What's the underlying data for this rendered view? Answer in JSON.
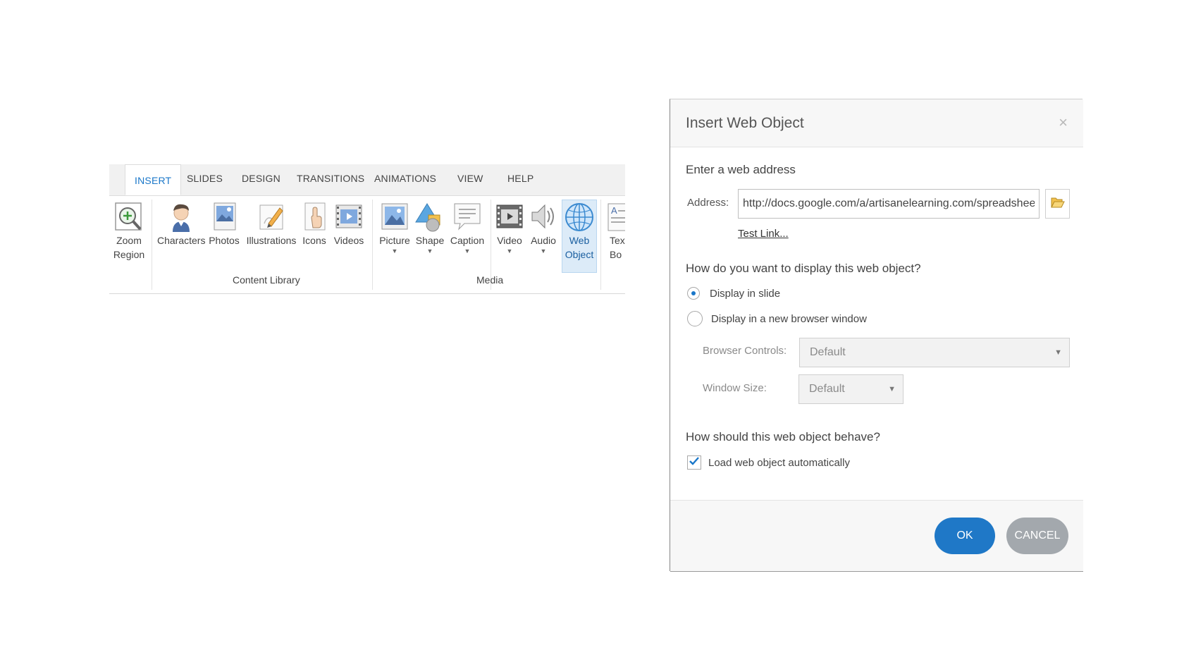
{
  "ribbon": {
    "tabs": [
      "INSERT",
      "SLIDES",
      "DESIGN",
      "TRANSITIONS",
      "ANIMATIONS",
      "VIEW",
      "HELP"
    ],
    "active_tab": "INSERT",
    "zoom_region": {
      "line1": "Zoom",
      "line2": "Region",
      "icon": "zoom-in-icon"
    },
    "content_library": {
      "group_label": "Content Library",
      "items": [
        {
          "label": "Characters",
          "icon": "character-icon"
        },
        {
          "label": "Photos",
          "icon": "photo-icon"
        },
        {
          "label": "Illustrations",
          "icon": "illustration-icon"
        },
        {
          "label": "Icons",
          "icon": "hand-pointer-icon"
        },
        {
          "label": "Videos",
          "icon": "film-icon"
        }
      ]
    },
    "media": {
      "group_label": "Media",
      "items": [
        {
          "label": "Picture",
          "icon": "picture-icon",
          "has_dropdown": true
        },
        {
          "label": "Shape",
          "icon": "shape-icon",
          "has_dropdown": true
        },
        {
          "label": "Caption",
          "icon": "caption-icon",
          "has_dropdown": true
        },
        {
          "label": "Video",
          "icon": "video-icon",
          "has_dropdown": true
        },
        {
          "label": "Audio",
          "icon": "speaker-icon",
          "has_dropdown": true
        }
      ]
    },
    "web_object": {
      "line1": "Web",
      "line2": "Object",
      "icon": "globe-icon",
      "selected": true
    },
    "text_box": {
      "line1": "Tex",
      "line2": "Bo",
      "icon": "text-box-icon"
    },
    "dropdown_arrow": "▼"
  },
  "dialog": {
    "title": "Insert Web Object",
    "close_glyph": "×",
    "web_address_heading": "Enter a web address",
    "address_label": "Address:",
    "address_value": "http://docs.google.com/a/artisanelearning.com/spreadsheets",
    "browse_icon": "folder-open-icon",
    "test_link": "Test Link...",
    "display_heading": "How do you want to display this web object?",
    "display_options": [
      {
        "label": "Display in slide",
        "selected": true
      },
      {
        "label": "Display in a new browser window",
        "selected": false
      }
    ],
    "browser_controls_label": "Browser Controls:",
    "browser_controls_value": "Default",
    "window_size_label": "Window Size:",
    "window_size_value": "Default",
    "behave_heading": "How should this web object behave?",
    "load_auto_label": "Load web object automatically",
    "load_auto_checked": true,
    "ok_label": "OK",
    "cancel_label": "CANCEL",
    "caret_glyph": "▼"
  },
  "colors": {
    "accent": "#1f78c7",
    "cancel": "#a3a8ad",
    "selected_bg": "#dcebf8"
  }
}
